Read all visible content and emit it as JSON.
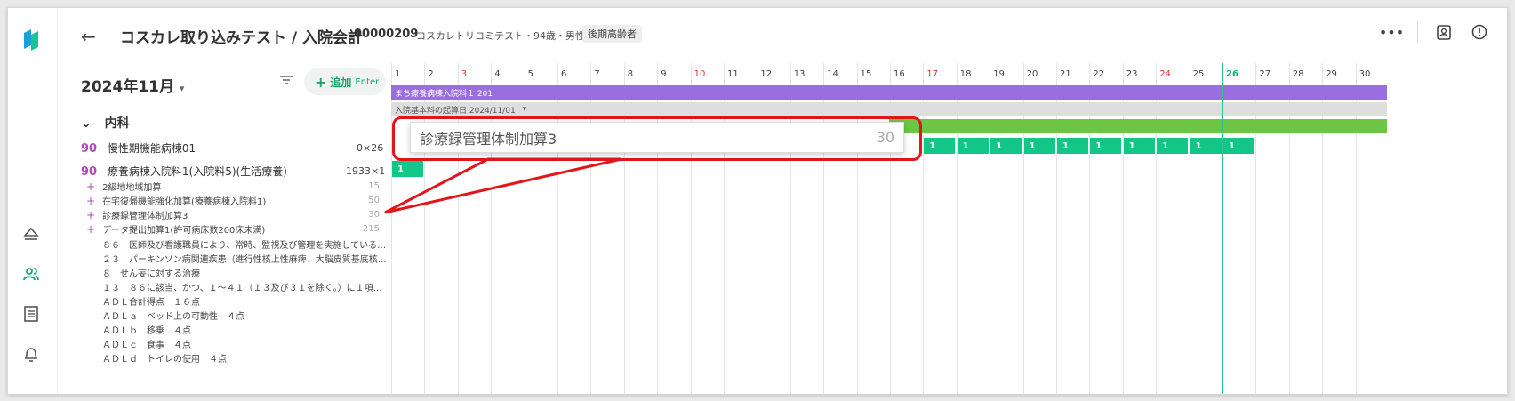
{
  "header": {
    "back_icon": "arrow-left-icon",
    "title": "コスカレ取り込みテスト / 入院会計",
    "patient_id": "00000209",
    "patient_info": "・コスカレトリコミテスト・94歳・男性",
    "badge": "後期高齢者",
    "icons": [
      "more-icon",
      "id-card-icon",
      "alert-circle-icon"
    ]
  },
  "rail": {
    "logo": "app-logo",
    "items": [
      "eject-icon",
      "patients-icon",
      "list-icon",
      "bell-icon"
    ],
    "accent": "#1aa56b"
  },
  "toolbar": {
    "month": "2024年11月",
    "month_caret": "▾",
    "add_label": "追加",
    "add_hint": "Enter",
    "add_icon": "+"
  },
  "section": {
    "caret": "⌄",
    "label": "内科"
  },
  "rows": [
    {
      "num": "90",
      "label": "慢性期機能病棟01",
      "value": "0×26"
    },
    {
      "num": "90",
      "label": "療養病棟入院料1(入院料5)(生活療養)",
      "value": "1933×1"
    }
  ],
  "subitems": [
    {
      "label": "2級地地域加算",
      "value": "15"
    },
    {
      "label": "在宅復帰機能強化加算(療養病棟入院料1)",
      "value": "50"
    },
    {
      "label": "診療録管理体制加算3",
      "value": "30"
    },
    {
      "label": "データ提出加算1(許可病床数200床未満)",
      "value": "215"
    }
  ],
  "notes": [
    "８６　医師及び看護職員により、常時、監視及び管理を実施している…",
    "２３　パーキンソン病関連疾患（進行性核上性麻痺、大脳皮質基底核…",
    "８　せん妄に対する治療",
    "１３　８６に該当、かつ、１～４１（１３及び３１を除く。）に１項…",
    "ＡＤＬ合計得点　１６点",
    "ＡＤＬａ　ベッド上の可動性　４点",
    "ＡＤＬｂ　移乗　４点",
    "ＡＤＬｃ　食事　４点",
    "ＡＤＬｄ　トイレの使用　４点"
  ],
  "calendar": {
    "days": [
      "1",
      "2",
      "3",
      "4",
      "5",
      "6",
      "7",
      "8",
      "9",
      "10",
      "11",
      "12",
      "13",
      "14",
      "15",
      "16",
      "17",
      "18",
      "19",
      "20",
      "21",
      "22",
      "23",
      "24",
      "25",
      "26",
      "27",
      "28",
      "29",
      "30"
    ],
    "red_days": [
      "3",
      "10",
      "17",
      "24"
    ],
    "today": "26",
    "purple_bar": "まち療養病棟入院料１ 201",
    "gray_bar": "入院基本料の起算日 2024/11/01",
    "gray_caret": "▾",
    "cell_value": "1",
    "colors": {
      "purple": "#9b6ee0",
      "gray": "#dedede",
      "green": "#6cc644",
      "teal": "#12c688"
    }
  },
  "popup": {
    "label": "診療録管理体制加算3",
    "value": "30"
  }
}
